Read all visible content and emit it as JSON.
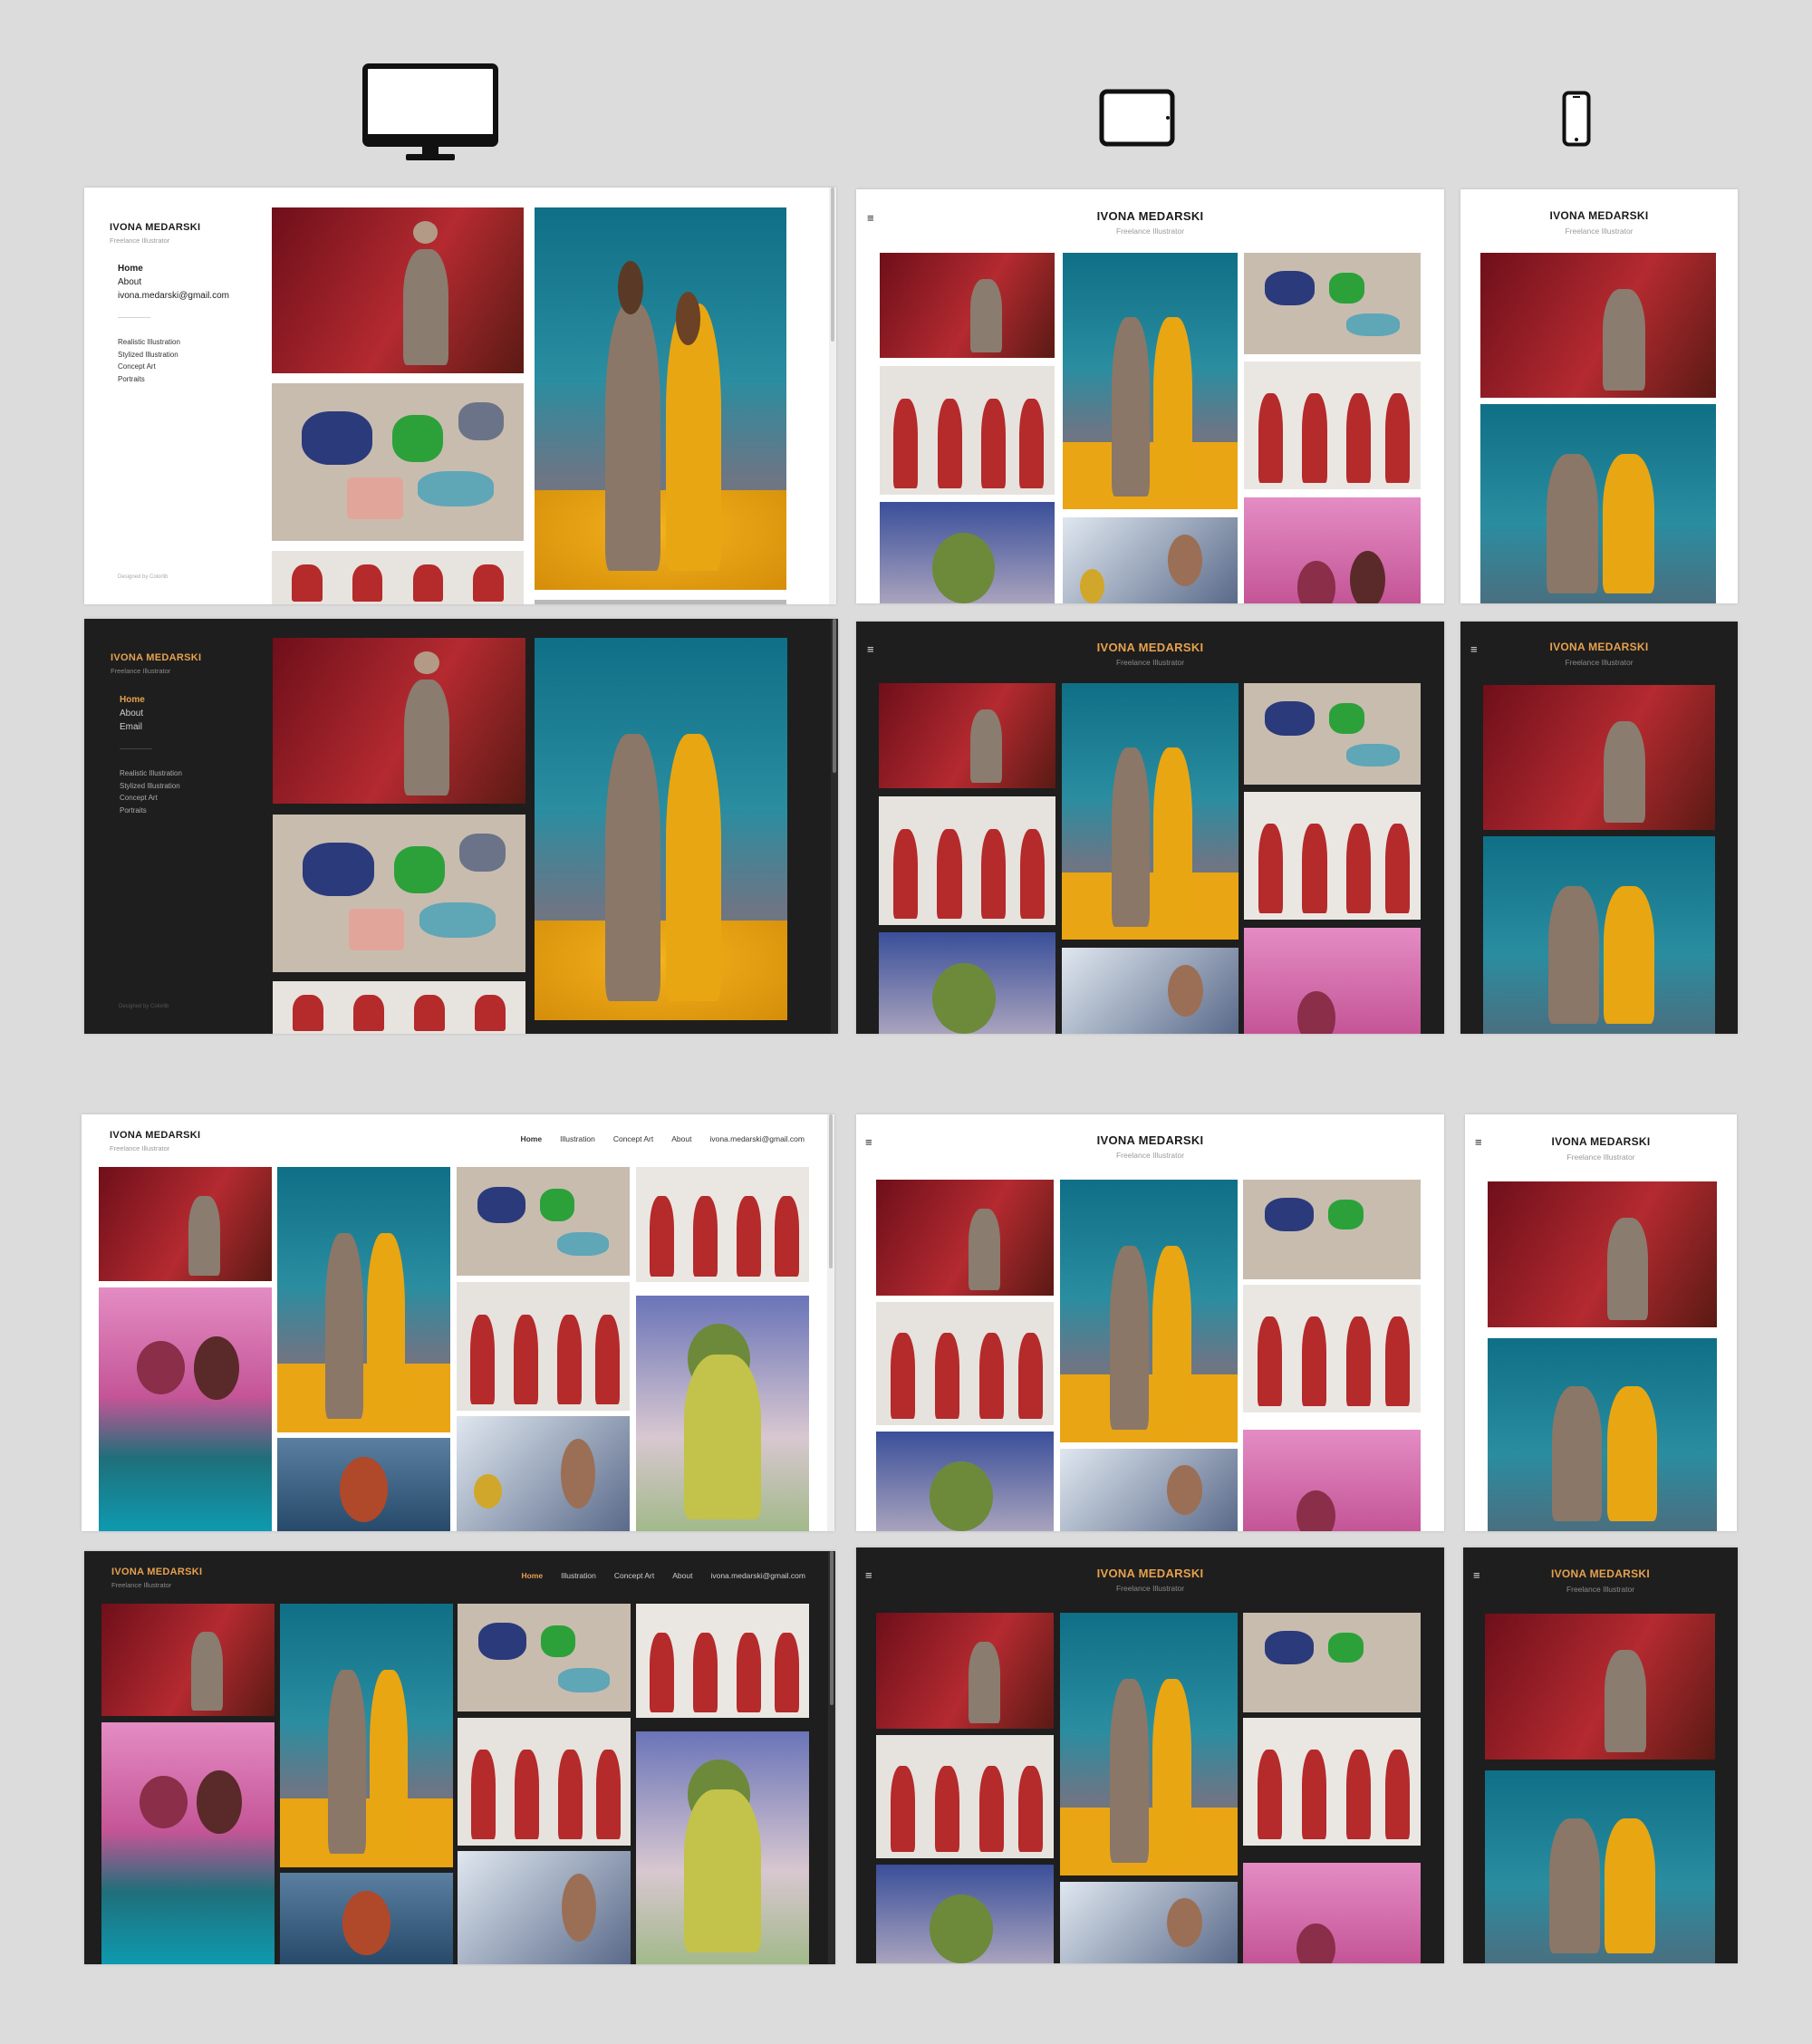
{
  "site": {
    "name": "IVONA MEDARSKI",
    "tagline": "Freelance Illustrator",
    "email": "ivona.medarski@gmail.com",
    "credit": "Designed by Colorlib"
  },
  "sidebar_nav": {
    "home": "Home",
    "about": "About",
    "email_label": "Email",
    "categories": [
      "Realistic Illustration",
      "Stylized Illustration",
      "Concept Art",
      "Portraits"
    ]
  },
  "top_nav": {
    "home": "Home",
    "illustration": "Illustration",
    "concept_art": "Concept Art",
    "about": "About",
    "email": "ivona.medarski@gmail.com"
  },
  "menu_icon": "≡",
  "icons": [
    "desktop-monitor-icon",
    "tablet-icon",
    "phone-icon",
    "menu-icon"
  ],
  "colors": {
    "background": "#dcdcdc",
    "light_theme_bg": "#ffffff",
    "dark_theme_bg": "#1e1e1e",
    "dark_accent": "#e6a14e"
  },
  "artworks": [
    "red-door-figure",
    "couple-teal-gold",
    "items-concept",
    "red-robes-lineup",
    "red-robes-front",
    "pink-couple",
    "green-elf",
    "knight-skull",
    "red-hair-woman"
  ]
}
